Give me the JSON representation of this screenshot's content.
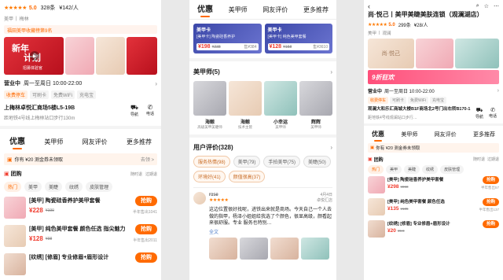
{
  "panel1": {
    "rating": "5.0",
    "rating_stars": "★★★★★",
    "reviews": "328条",
    "price": "¥142/人",
    "category": "美甲",
    "area": "梅林",
    "rank_banner": "福田美甲收藏榜第9名",
    "hero_text1": "新年",
    "hero_text2": "计划",
    "hero_sub": "招募体验官",
    "hours_label": "营业中",
    "hours": "周一至周日 10:00-22:00",
    "facility_tags": [
      "收费停车",
      "可刷卡",
      "免费WiFi",
      "充电宝"
    ],
    "address": "上梅林卓悦汇商场5楼L5-19B",
    "distance": "距地铁4号线上梅林站口步行130m",
    "nav_label": "导航",
    "phone_label": "电话",
    "tabs": [
      "优惠",
      "美甲师",
      "网友评价",
      "更多推荐"
    ],
    "coupon_text": "你有 ¥20 测金券未领取",
    "coupon_action": "去领 >",
    "deals_label": "团购",
    "deals_tags": [
      "随时退",
      "过期退"
    ],
    "filters": [
      "热门",
      "美甲",
      "美睫",
      "纹绣",
      "皮肤管理"
    ],
    "deals": [
      {
        "title": "[美甲] 陶瓷硅香养护美甲套餐",
        "price": "¥228",
        "orig": "¥190",
        "count": "半年售出1041",
        "buy": "抢购"
      },
      {
        "title": "[美甲] 纯色美甲套餐 颜色任选 指尖魅力",
        "price": "¥128",
        "orig": "¥98",
        "count": "半年售出2011",
        "buy": "抢购"
      },
      {
        "title": "[纹绣] [修眉] 专业修眉+眉形设计",
        "price": "",
        "orig": "",
        "count": "",
        "buy": "抢购"
      }
    ]
  },
  "panel2": {
    "tabs": [
      "优惠",
      "美甲师",
      "网友评价",
      "更多推荐"
    ],
    "coupons": [
      {
        "title": "美甲卡",
        "desc": "[美甲卡] 陶瓷硅香养护",
        "price": "¥198",
        "orig": "¥238",
        "cnt": "售¥384"
      },
      {
        "title": "美甲卡",
        "desc": "[美甲卡] 纯色美甲套餐",
        "price": "¥128",
        "orig": "¥158",
        "cnt": "售¥3610"
      }
    ],
    "artists_label": "美甲师(5)",
    "artists": [
      {
        "name": "海鲸",
        "role": "高级美甲美睫师"
      },
      {
        "name": "海鲸",
        "role": "技术主管"
      },
      {
        "name": "小幸运",
        "role": "美甲师"
      },
      {
        "name": "辉辉",
        "role": "美甲师"
      }
    ],
    "reviews_label": "用户评价(328)",
    "review_chips": [
      {
        "label": "服务热情(98)",
        "hot": true
      },
      {
        "label": "美甲(79)",
        "hot": false
      },
      {
        "label": "手拍美甲(75)",
        "hot": false
      },
      {
        "label": "美睫(50)",
        "hot": false
      },
      {
        "label": "环境好(41)",
        "hot": true
      },
      {
        "label": "颜值很高(37)",
        "hot": true
      }
    ],
    "reviewer": "rose",
    "review_stars": "★★★★★",
    "review_date": "4月4日",
    "review_store": "卓悦汇店",
    "review_text": "这边位置很好找呢，进铁出来就是商场。今天自己一个人去做的指甲，杨泽小姐姐给我选了个颜色，很显高级，颜看起来很舒服。专业 服务也特别…",
    "review_more": "全文"
  },
  "panel3": {
    "title": "尚·悦己丨美甲美睫美肤连锁（观澜湖店）",
    "rating_stars": "★★★★★",
    "rating": "5.0",
    "reviews": "299条",
    "price": "¥28/人",
    "category": "美甲",
    "area": "观澜",
    "brand_text": "尚·悦己",
    "promo_text": "9折狂欢",
    "hours_label": "营业中",
    "hours": "周一至周日 10:00-22:00",
    "facility_tags": [
      "收费停车",
      "可刷卡",
      "免费WiFi",
      "充电宝"
    ],
    "address": "观澜大和乐汇商城大楼B1F商场北2号门出右转B170-1",
    "distance": "距地铁4号线观澜站口步行…",
    "nav_label": "导航",
    "phone_label": "电话",
    "tabs": [
      "优惠",
      "美甲师",
      "网友评价",
      "更多推荐"
    ],
    "coupon_text": "你有 ¥20 测金券未领取",
    "deals_label": "团购",
    "deals_tags": [
      "随时退",
      "过期退"
    ],
    "filters": [
      "热门",
      "美甲",
      "美睫",
      "纹绣",
      "皮肤管理"
    ],
    "deals": [
      {
        "title": "[美甲] 陶瓷硅香养护美甲套餐",
        "price": "¥298",
        "orig": "¥268",
        "count": "半年售出57",
        "buy": "抢购"
      },
      {
        "title": "[美甲] 纯色美甲套餐 颜色任选",
        "price": "¥135",
        "orig": "¥105",
        "count": "半年售出137",
        "buy": "抢购"
      },
      {
        "title": "[纹绣] [修眉] 专业修眉+眉形设计",
        "price": "¥20",
        "orig": "¥9.9",
        "count": "",
        "buy": "抢购"
      }
    ]
  }
}
